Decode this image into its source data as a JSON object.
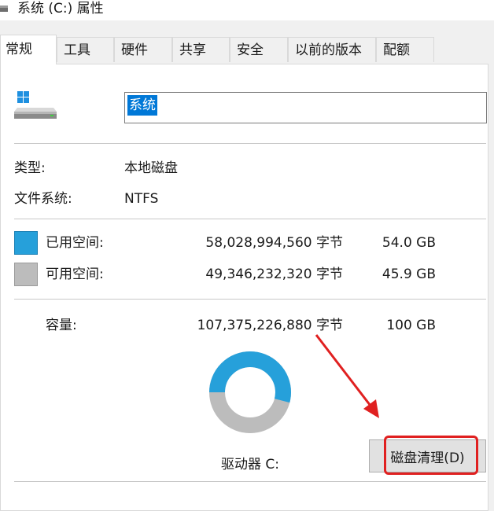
{
  "window": {
    "title": "系统 (C:) 属性",
    "icon": "drive-icon"
  },
  "tabs": [
    {
      "label": "常规",
      "active": true
    },
    {
      "label": "工具"
    },
    {
      "label": "硬件"
    },
    {
      "label": "共享"
    },
    {
      "label": "安全"
    },
    {
      "label": "以前的版本"
    },
    {
      "label": "配额"
    }
  ],
  "drive": {
    "name": "系统",
    "icon": "windows-drive-icon"
  },
  "info": {
    "type_label": "类型:",
    "type_value": "本地磁盘",
    "fs_label": "文件系统:",
    "fs_value": "NTFS"
  },
  "space": {
    "used_label": "已用空间:",
    "used_bytes": "58,028,994,560 字节",
    "used_size": "54.0 GB",
    "used_color": "#26a0da",
    "free_label": "可用空间:",
    "free_bytes": "49,346,232,320 字节",
    "free_size": "45.9 GB",
    "free_color": "#bcbcbc",
    "capacity_label": "容量:",
    "capacity_bytes": "107,375,226,880 字节",
    "capacity_size": "100 GB",
    "used_fraction": 0.54
  },
  "drive_label": "驱动器 C:",
  "buttons": {
    "disk_cleanup": "磁盘清理(D)"
  },
  "annotation": {
    "color": "#e02020"
  }
}
